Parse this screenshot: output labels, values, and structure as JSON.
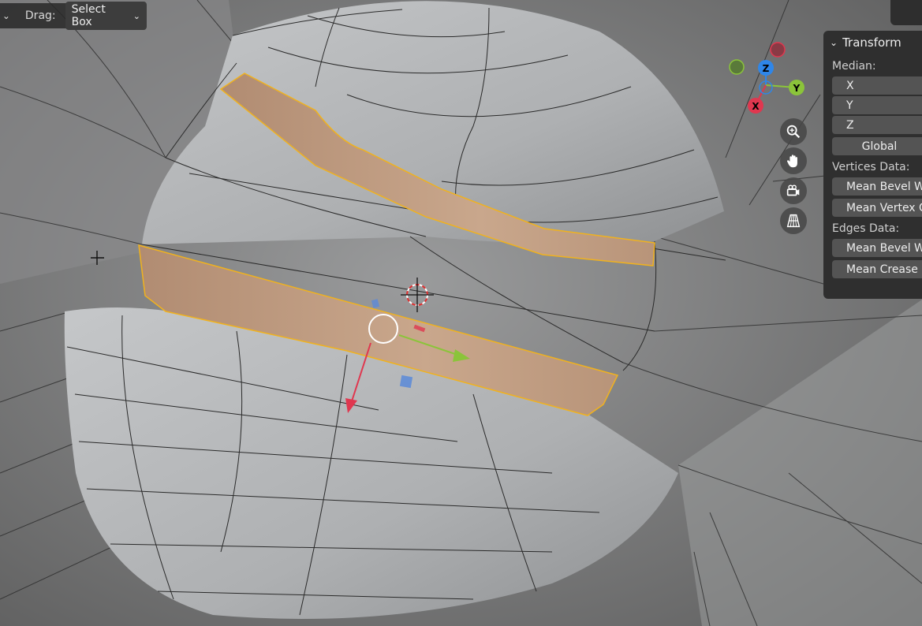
{
  "header": {
    "drag_label": "Drag:",
    "select_mode": "Select Box"
  },
  "navigation_gizmo": {
    "axis_x": "X",
    "axis_y": "Y",
    "axis_z": "Z",
    "colors": {
      "x": "#e0374f",
      "y": "#8bc43a",
      "z": "#2f86e8"
    }
  },
  "view_tools": [
    "zoom-icon",
    "pan-hand-icon",
    "camera-icon",
    "grid-perspective-icon"
  ],
  "n_panel": {
    "section_title": "Transform",
    "median_label": "Median:",
    "fields": [
      "X",
      "Y",
      "Z"
    ],
    "space_button": "Global",
    "vertices_label": "Vertices Data:",
    "vertices_fields": [
      "Mean Bevel W",
      "Mean Vertex C"
    ],
    "edges_label": "Edges Data:",
    "edges_fields": [
      "Mean Bevel W",
      "Mean Crease"
    ]
  },
  "colors": {
    "selection_outline": "#f0b21e",
    "selection_face": "#c9a488",
    "mesh": "#b4b6b8"
  }
}
